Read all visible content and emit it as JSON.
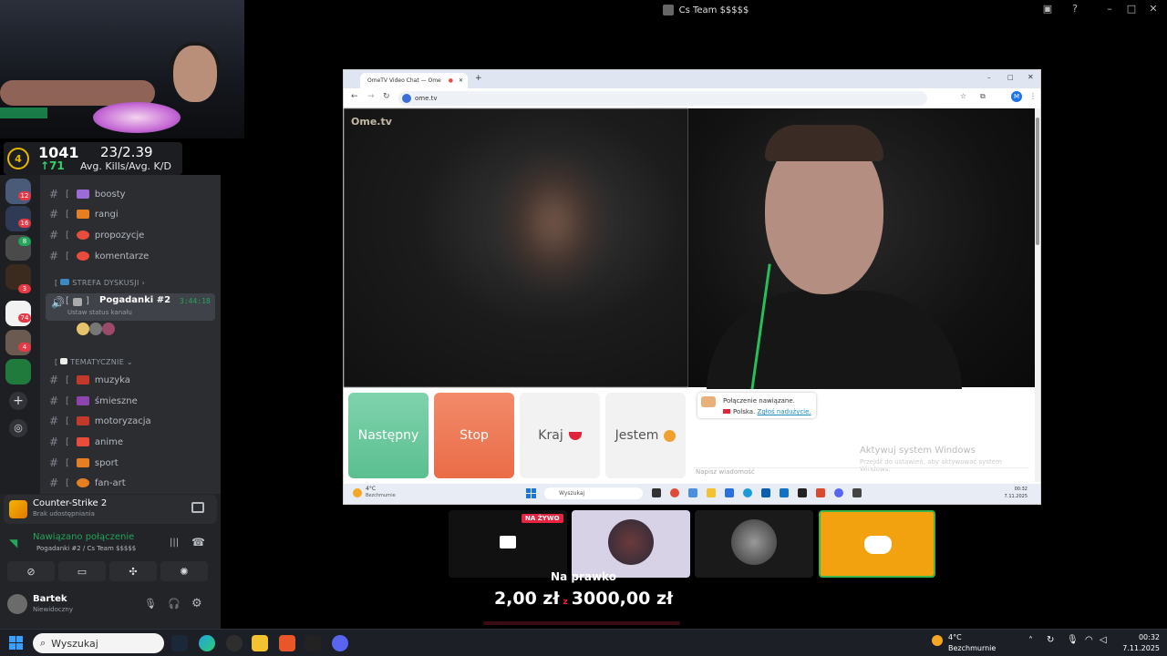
{
  "window": {
    "title": "Cs Team $$$$$"
  },
  "stats": {
    "level": "4",
    "elo": "1041",
    "elo_delta": "↑71",
    "kills_kd": "23/2.39",
    "kills_kd_label": "Avg. Kills/Avg. K/D"
  },
  "servers": {
    "badges": [
      "12",
      "16",
      "8",
      "3",
      "74",
      "4"
    ]
  },
  "channels": {
    "top": [
      {
        "label": "boosty",
        "color": "#9b6bd6"
      },
      {
        "label": "rangi",
        "color": "#e67e22"
      },
      {
        "label": "propozycje",
        "color": "#e74c3c"
      },
      {
        "label": "komentarze",
        "color": "#e74c3c"
      }
    ],
    "category_discussion": "STREFA DYSKUSJI",
    "voice": {
      "name": "Pogadanki #2",
      "timer": "3:44:18",
      "status": "Ustaw status kanału"
    },
    "category_thematic": "TEMATYCZNIE",
    "thematic": [
      {
        "label": "muzyka",
        "color": "#c0392b"
      },
      {
        "label": "śmieszne",
        "color": "#8e44ad"
      },
      {
        "label": "motoryzacja",
        "color": "#c0392b"
      },
      {
        "label": "anime",
        "color": "#e74c3c"
      },
      {
        "label": "sport",
        "color": "#e67e22"
      },
      {
        "label": "fan-art",
        "color": "#e67e22"
      }
    ]
  },
  "panel": {
    "game": "Counter-Strike 2",
    "game_sub": "Brak udostępniania",
    "connection": "Nawiązano połączenie",
    "connection_sub": "Pogadanki #2 / Cs Team $$$$$",
    "user": "Bartek",
    "user_status": "Niewidoczny"
  },
  "browser": {
    "tab_title": "OmeTV Video Chat — Ome",
    "url": "ome.tv",
    "logo": "Ome.tv",
    "btn_next": "Następny",
    "btn_stop": "Stop",
    "btn_country": "Kraj",
    "btn_gender": "Jestem",
    "chat_line1": "Połączenie nawiązane.",
    "chat_country": "Polska.",
    "chat_report": "Zgłoś nadużycie.",
    "activate_title": "Aktywuj system Windows",
    "activate_sub": "Przejdź do ustawień, aby aktywować system Windows.",
    "chat_placeholder": "Napisz wiadomość",
    "inner_weather_temp": "4°C",
    "inner_weather_desc": "Bezchmurnie",
    "inner_search": "Wyszukaj",
    "inner_time": "00:32",
    "inner_date": "7.11.2025"
  },
  "overlay": {
    "live_badge": "NA ŻYWO",
    "bet_title": "Na prawko",
    "amount_current": "2,00 zł",
    "amount_sep": "z",
    "amount_goal": "3000,00 zł"
  },
  "taskbar": {
    "search": "Wyszukaj",
    "weather_temp": "4°C",
    "weather_desc": "Bezchmurnie",
    "time": "00:32",
    "date": "7.11.2025"
  },
  "colors": {
    "next_btn": "#6ccaa0",
    "stop_btn": "#ef7e5c",
    "discord_tile": "#f1a20e",
    "accent_green": "#23a55a"
  }
}
